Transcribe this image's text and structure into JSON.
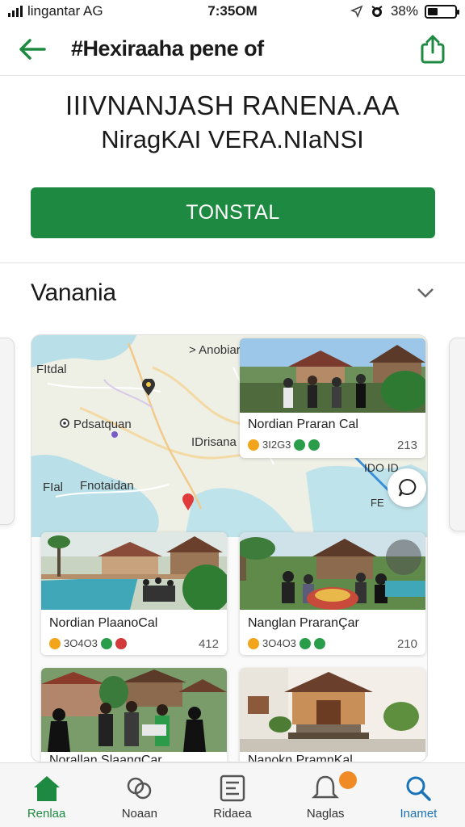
{
  "status_bar": {
    "carrier": "lingantar AG",
    "time": "7:35OM",
    "battery_percent": "38%",
    "battery_level": 0.38
  },
  "header": {
    "title": "#Hexiraaha pene of",
    "back_icon": "arrow-left-icon",
    "share_icon": "share-icon"
  },
  "headline": {
    "line1": "IIIVNANJASH RANENA.AA",
    "line2": "NiragKAI VERA.NIaNSI"
  },
  "primary_button": {
    "label": "TONSTAL"
  },
  "section": {
    "label": "Vanania",
    "chevron_icon": "chevron-down-icon"
  },
  "map": {
    "labels": [
      "> Anobiara",
      "FItdal",
      "Pdsatquan",
      "IDrisana",
      "FIal",
      "Fnotaidan",
      "IDO ID",
      "FE"
    ]
  },
  "cards": [
    {
      "title": "Nordian Praran Cal",
      "meta": "3I2G3",
      "count": "213"
    },
    {
      "title": "Nordian PlaanoCal",
      "meta": "3O4O3",
      "count": "412"
    },
    {
      "title": "Nanglan PraranÇar",
      "meta": "3O4O3",
      "count": "210"
    },
    {
      "title": "Norallan SlaangCar",
      "meta": "",
      "count": ""
    },
    {
      "title": "Nanokn PramnKal",
      "meta": "",
      "count": ""
    }
  ],
  "nav": [
    {
      "label": "Renlaa",
      "icon": "home-icon"
    },
    {
      "label": "Noaan",
      "icon": "link-icon"
    },
    {
      "label": "Ridaea",
      "icon": "document-icon"
    },
    {
      "label": "Naglas",
      "icon": "bell-icon"
    },
    {
      "label": "Inamet",
      "icon": "search-icon"
    }
  ],
  "colors": {
    "primary": "#1e8a41",
    "accent_blue": "#1a73b8",
    "badge": "#f08a24"
  }
}
